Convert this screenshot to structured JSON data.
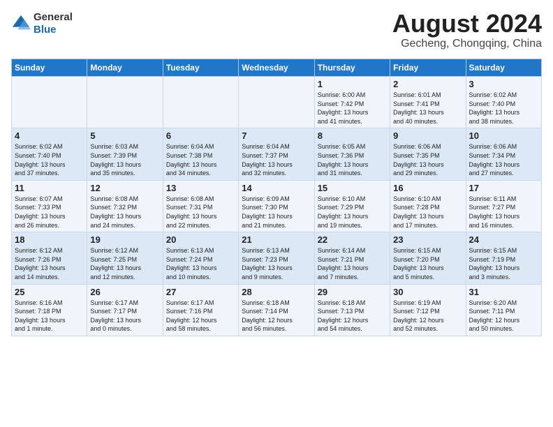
{
  "header": {
    "logo": {
      "general": "General",
      "blue": "Blue"
    },
    "title": "August 2024",
    "location": "Gecheng, Chongqing, China"
  },
  "days_of_week": [
    "Sunday",
    "Monday",
    "Tuesday",
    "Wednesday",
    "Thursday",
    "Friday",
    "Saturday"
  ],
  "weeks": [
    [
      {
        "day": "",
        "info": ""
      },
      {
        "day": "",
        "info": ""
      },
      {
        "day": "",
        "info": ""
      },
      {
        "day": "",
        "info": ""
      },
      {
        "day": "1",
        "info": "Sunrise: 6:00 AM\nSunset: 7:42 PM\nDaylight: 13 hours\nand 41 minutes."
      },
      {
        "day": "2",
        "info": "Sunrise: 6:01 AM\nSunset: 7:41 PM\nDaylight: 13 hours\nand 40 minutes."
      },
      {
        "day": "3",
        "info": "Sunrise: 6:02 AM\nSunset: 7:40 PM\nDaylight: 13 hours\nand 38 minutes."
      }
    ],
    [
      {
        "day": "4",
        "info": "Sunrise: 6:02 AM\nSunset: 7:40 PM\nDaylight: 13 hours\nand 37 minutes."
      },
      {
        "day": "5",
        "info": "Sunrise: 6:03 AM\nSunset: 7:39 PM\nDaylight: 13 hours\nand 35 minutes."
      },
      {
        "day": "6",
        "info": "Sunrise: 6:04 AM\nSunset: 7:38 PM\nDaylight: 13 hours\nand 34 minutes."
      },
      {
        "day": "7",
        "info": "Sunrise: 6:04 AM\nSunset: 7:37 PM\nDaylight: 13 hours\nand 32 minutes."
      },
      {
        "day": "8",
        "info": "Sunrise: 6:05 AM\nSunset: 7:36 PM\nDaylight: 13 hours\nand 31 minutes."
      },
      {
        "day": "9",
        "info": "Sunrise: 6:06 AM\nSunset: 7:35 PM\nDaylight: 13 hours\nand 29 minutes."
      },
      {
        "day": "10",
        "info": "Sunrise: 6:06 AM\nSunset: 7:34 PM\nDaylight: 13 hours\nand 27 minutes."
      }
    ],
    [
      {
        "day": "11",
        "info": "Sunrise: 6:07 AM\nSunset: 7:33 PM\nDaylight: 13 hours\nand 26 minutes."
      },
      {
        "day": "12",
        "info": "Sunrise: 6:08 AM\nSunset: 7:32 PM\nDaylight: 13 hours\nand 24 minutes."
      },
      {
        "day": "13",
        "info": "Sunrise: 6:08 AM\nSunset: 7:31 PM\nDaylight: 13 hours\nand 22 minutes."
      },
      {
        "day": "14",
        "info": "Sunrise: 6:09 AM\nSunset: 7:30 PM\nDaylight: 13 hours\nand 21 minutes."
      },
      {
        "day": "15",
        "info": "Sunrise: 6:10 AM\nSunset: 7:29 PM\nDaylight: 13 hours\nand 19 minutes."
      },
      {
        "day": "16",
        "info": "Sunrise: 6:10 AM\nSunset: 7:28 PM\nDaylight: 13 hours\nand 17 minutes."
      },
      {
        "day": "17",
        "info": "Sunrise: 6:11 AM\nSunset: 7:27 PM\nDaylight: 13 hours\nand 16 minutes."
      }
    ],
    [
      {
        "day": "18",
        "info": "Sunrise: 6:12 AM\nSunset: 7:26 PM\nDaylight: 13 hours\nand 14 minutes."
      },
      {
        "day": "19",
        "info": "Sunrise: 6:12 AM\nSunset: 7:25 PM\nDaylight: 13 hours\nand 12 minutes."
      },
      {
        "day": "20",
        "info": "Sunrise: 6:13 AM\nSunset: 7:24 PM\nDaylight: 13 hours\nand 10 minutes."
      },
      {
        "day": "21",
        "info": "Sunrise: 6:13 AM\nSunset: 7:23 PM\nDaylight: 13 hours\nand 9 minutes."
      },
      {
        "day": "22",
        "info": "Sunrise: 6:14 AM\nSunset: 7:21 PM\nDaylight: 13 hours\nand 7 minutes."
      },
      {
        "day": "23",
        "info": "Sunrise: 6:15 AM\nSunset: 7:20 PM\nDaylight: 13 hours\nand 5 minutes."
      },
      {
        "day": "24",
        "info": "Sunrise: 6:15 AM\nSunset: 7:19 PM\nDaylight: 13 hours\nand 3 minutes."
      }
    ],
    [
      {
        "day": "25",
        "info": "Sunrise: 6:16 AM\nSunset: 7:18 PM\nDaylight: 13 hours\nand 1 minute."
      },
      {
        "day": "26",
        "info": "Sunrise: 6:17 AM\nSunset: 7:17 PM\nDaylight: 13 hours\nand 0 minutes."
      },
      {
        "day": "27",
        "info": "Sunrise: 6:17 AM\nSunset: 7:16 PM\nDaylight: 12 hours\nand 58 minutes."
      },
      {
        "day": "28",
        "info": "Sunrise: 6:18 AM\nSunset: 7:14 PM\nDaylight: 12 hours\nand 56 minutes."
      },
      {
        "day": "29",
        "info": "Sunrise: 6:18 AM\nSunset: 7:13 PM\nDaylight: 12 hours\nand 54 minutes."
      },
      {
        "day": "30",
        "info": "Sunrise: 6:19 AM\nSunset: 7:12 PM\nDaylight: 12 hours\nand 52 minutes."
      },
      {
        "day": "31",
        "info": "Sunrise: 6:20 AM\nSunset: 7:11 PM\nDaylight: 12 hours\nand 50 minutes."
      }
    ]
  ]
}
